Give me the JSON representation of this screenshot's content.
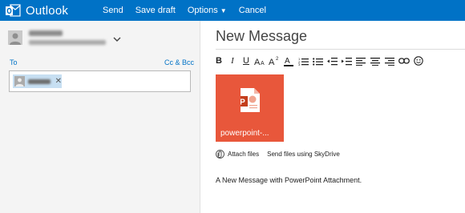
{
  "app": {
    "name": "Outlook",
    "brand_color": "#0072c6",
    "logo_icon": "outlook-logo-icon"
  },
  "commands": {
    "send": "Send",
    "save_draft": "Save draft",
    "options": "Options",
    "cancel": "Cancel"
  },
  "compose": {
    "to_label": "To",
    "cc_bcc_label": "Cc & Bcc",
    "title": "New Message",
    "attachment": {
      "name": "powerpoint-...",
      "tile_color": "#e8573b",
      "icon": "powerpoint-file-icon"
    },
    "attach_files_label": "Attach files",
    "skydrive_label": "Send files using SkyDrive",
    "body": "A New Message with PowerPoint Attachment."
  },
  "toolbar_icons": [
    "bold-icon",
    "italic-icon",
    "underline-icon",
    "font-size-icon",
    "superscript-icon",
    "font-color-icon",
    "numbered-list-icon",
    "bullet-list-icon",
    "decrease-indent-icon",
    "increase-indent-icon",
    "align-left-icon",
    "align-center-icon",
    "align-right-icon",
    "link-icon",
    "emoticon-icon"
  ]
}
